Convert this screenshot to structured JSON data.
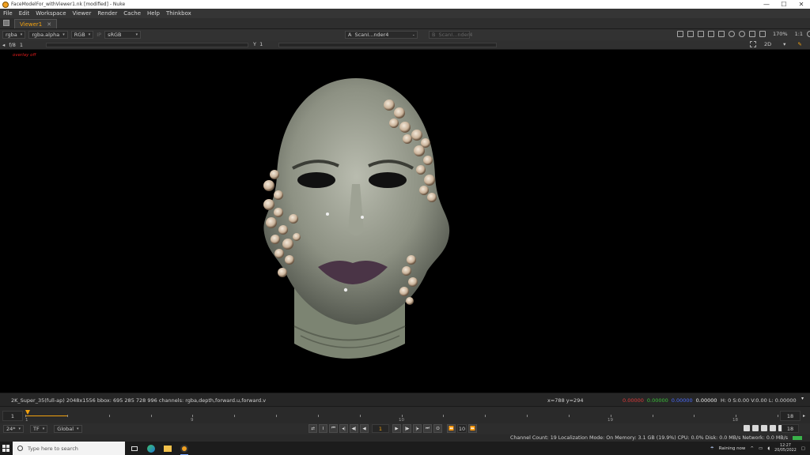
{
  "window": {
    "title": "FaceModelFor_withViewer1.nk [modified] - Nuke",
    "minimize": "—",
    "maximize": "☐",
    "close": "✕"
  },
  "menu": [
    "File",
    "Edit",
    "Workspace",
    "Viewer",
    "Render",
    "Cache",
    "Help",
    "Thinkbox"
  ],
  "tab": {
    "label": "Viewer1",
    "close": "✕"
  },
  "viewer_controls": {
    "channels": "rgba",
    "alpha": "rgba.alpha",
    "display_channel": "RGB",
    "ip": "IP",
    "lut": "sRGB",
    "input_a_letter": "A",
    "input_a": "ScanI...nder4",
    "input_a_menu": "-",
    "input_b_letter": "B",
    "input_b": "ScanI...nder4",
    "zoom": "170%",
    "ratio": "1:1"
  },
  "viewer_controls2": {
    "fstop": "f/8",
    "frame_num": "1",
    "y_label": "Y",
    "y_value": "1",
    "view_mode": "2D"
  },
  "viewer": {
    "overlay_label": "overlay off"
  },
  "info_bar": {
    "format": "2K_Super_35(full-ap) 2048x1556  bbox: 695 285 728 996 channels: rgba,depth,forward.u,forward.v",
    "xy": "x=788 y=294",
    "r": "0.00000",
    "g": "0.00000",
    "b": "0.00000",
    "a": "0.00000",
    "hsv": "H:  0 S:0.00 V:0.00  L: 0.00000",
    "red_color": "#e23a3a",
    "green_color": "#3ac23a",
    "blue_color": "#4a6cff"
  },
  "timeline": {
    "start": "1",
    "end": "18",
    "labels": [
      "1",
      "9",
      "10",
      "19",
      "18"
    ],
    "current_frame": 1
  },
  "playback": {
    "fps": "24*",
    "tf": "TF",
    "scope": "Global",
    "frame": "1",
    "increment": "10",
    "end_field": "18"
  },
  "status": {
    "text": "Channel Count: 19  Localization Mode: On  Memory: 3.1 GB (19.9%)  CPU: 0.0%  Disk: 0.0 MB/s  Network: 0.0 MB/s",
    "indicator_color": "#3ab24a"
  },
  "taskbar": {
    "search_placeholder": "Type here to search",
    "weather": "Raining now",
    "time": "12:27",
    "date": "20/05/2022"
  }
}
